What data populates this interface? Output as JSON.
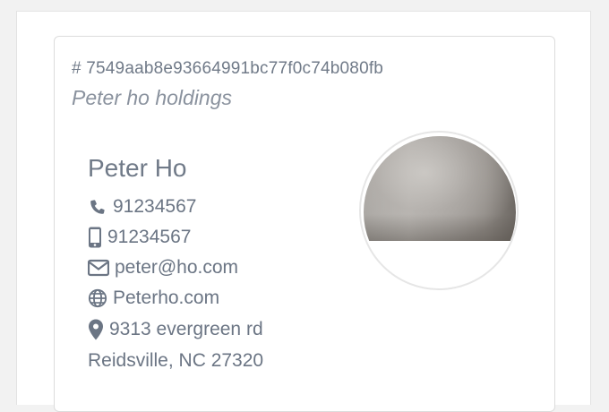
{
  "card": {
    "hash": "# 7549aab8e93664991bc77f0c74b080fb",
    "company": "Peter ho holdings",
    "name": "Peter Ho",
    "phone": "91234567",
    "mobile": "91234567",
    "email": "peter@ho.com",
    "website": "Peterho.com",
    "address_line1": "9313 evergreen rd",
    "address_line2": "Reidsville, NC 27320"
  },
  "icons": {
    "phone": "phone-icon",
    "mobile": "mobile-phone-icon",
    "email": "envelope-icon",
    "website": "globe-icon",
    "address": "map-marker-icon"
  },
  "colors": {
    "text": "#6b7584",
    "muted": "#8a929e",
    "border": "#dcdcdc",
    "background": "#f2f2f2"
  }
}
